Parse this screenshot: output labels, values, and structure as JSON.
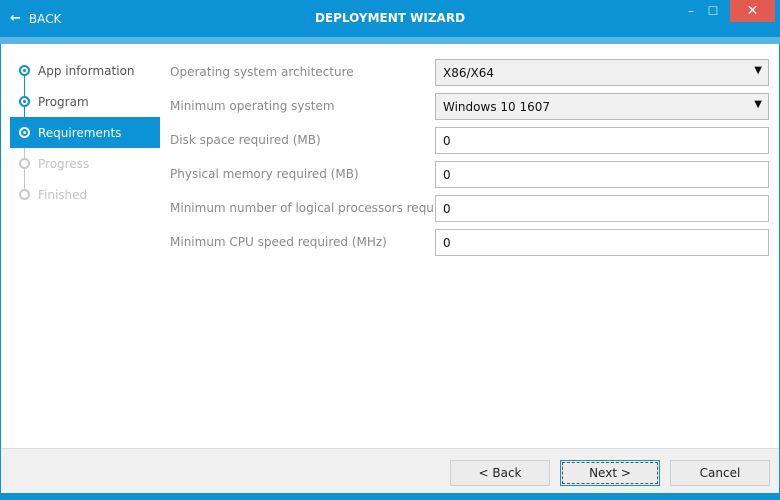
{
  "header": {
    "back_label": "BACK",
    "title": "DEPLOYMENT WIZARD",
    "minimize": "–",
    "maximize": "☐",
    "close": "✕"
  },
  "steps": [
    {
      "label": "App information",
      "state": "done"
    },
    {
      "label": "Program",
      "state": "done"
    },
    {
      "label": "Requirements",
      "state": "active"
    },
    {
      "label": "Progress",
      "state": "pending"
    },
    {
      "label": "Finished",
      "state": "pending"
    }
  ],
  "form": {
    "os_arch": {
      "label": "Operating system architecture",
      "value": "X86/X64"
    },
    "min_os": {
      "label": "Minimum operating system",
      "value": "Windows 10 1607"
    },
    "disk": {
      "label": "Disk space required (MB)",
      "value": "0"
    },
    "memory": {
      "label": "Physical memory required (MB)",
      "value": "0"
    },
    "processors": {
      "label": "Minimum number of logical processors required",
      "value": "0"
    },
    "cpu_speed": {
      "label": "Minimum CPU speed required (MHz)",
      "value": "0"
    }
  },
  "footer": {
    "back": "< Back",
    "next": "Next >",
    "cancel": "Cancel"
  }
}
